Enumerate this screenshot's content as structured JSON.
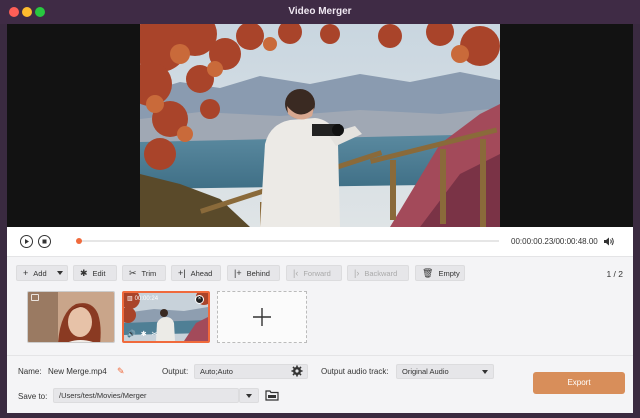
{
  "window": {
    "title": "Video Merger"
  },
  "player": {
    "time": "00:00:00.23/00:00:48.00",
    "progress": 0.005
  },
  "toolbar": {
    "add": "Add",
    "edit": "Edit",
    "trim": "Trim",
    "ahead": "Ahead",
    "behind": "Behind",
    "forward": "Forward",
    "backward": "Backward",
    "empty": "Empty",
    "page": "1 / 2"
  },
  "clips": [
    {
      "name": "clip-portrait"
    },
    {
      "name": "clip-photographer",
      "duration": "00:00:24"
    }
  ],
  "settings": {
    "name_label": "Name:",
    "name_value": "New Merge.mp4",
    "output_label": "Output:",
    "output_value": "Auto;Auto",
    "audio_label": "Output audio track:",
    "audio_value": "Original Audio",
    "save_label": "Save to:",
    "save_value": "/Users/test/Movies/Merger",
    "export_label": "Export"
  },
  "colors": {
    "accent": "#f06a3c",
    "export": "#d88e5a",
    "titlebar": "#3f2b45"
  }
}
